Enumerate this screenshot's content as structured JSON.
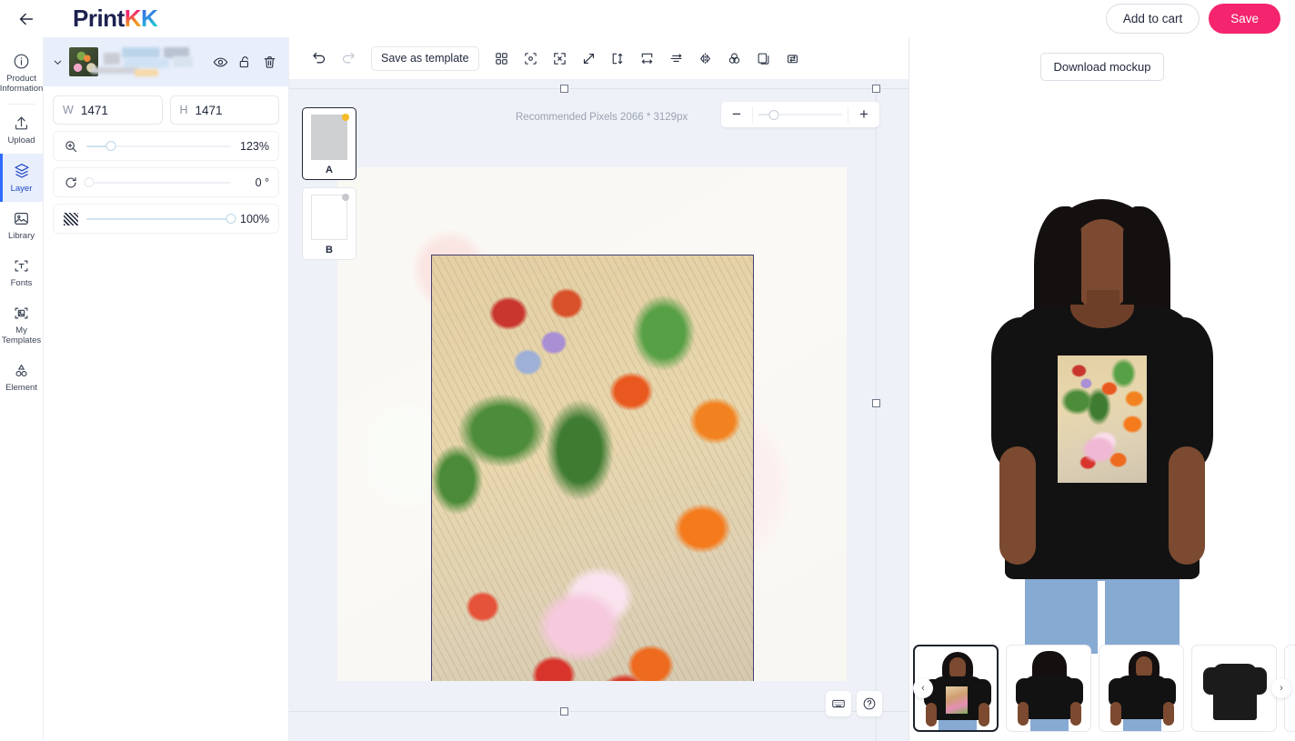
{
  "topbar": {
    "back_icon": "arrow-left-icon",
    "logo_part1": "Print",
    "logo_part2": "K",
    "logo_part3": "K",
    "add_to_cart_label": "Add to cart",
    "save_label": "Save",
    "save_color": "#f4246e"
  },
  "rail": {
    "items": [
      {
        "label": "Product\nInformation",
        "label_line1": "Product",
        "label_line2": "Information",
        "icon": "info-icon",
        "active": false
      },
      {
        "label": "Upload",
        "icon": "upload-icon",
        "active": false
      },
      {
        "label": "Layer",
        "icon": "layers-icon",
        "active": true
      },
      {
        "label": "Library",
        "icon": "image-icon",
        "active": false
      },
      {
        "label": "Fonts",
        "icon": "text-frame-icon",
        "active": false
      },
      {
        "label": "My\nTemplates",
        "label_line1": "My",
        "label_line2": "Templates",
        "icon": "image-frame-icon",
        "active": false
      },
      {
        "label": "Element",
        "icon": "shapes-icon",
        "active": false
      }
    ]
  },
  "properties": {
    "layer": {
      "collapse_icon": "chevron-down-icon",
      "thumbnail": "layer-thumbnail",
      "name_redacted": true,
      "visible_icon": "eye-icon",
      "lock_icon": "unlock-icon",
      "delete_icon": "trash-icon"
    },
    "width": {
      "label": "W",
      "value": "1471"
    },
    "height": {
      "label": "H",
      "value": "1471"
    },
    "scale": {
      "icon": "zoom-in-icon",
      "value": "123%",
      "percent": 17
    },
    "rotate": {
      "icon": "rotate-icon",
      "value": "0 °",
      "percent": 0
    },
    "opacity": {
      "icon": "opacity-icon",
      "value": "100%",
      "percent": 100
    }
  },
  "editor": {
    "toolbar": {
      "undo_icon": "undo-icon",
      "redo_icon": "redo-icon",
      "save_as_template_label": "Save as template",
      "tools": [
        {
          "icon": "grid-icon",
          "name": "grid-layout-tool"
        },
        {
          "icon": "center-icon",
          "name": "center-align-tool"
        },
        {
          "icon": "expand-icon",
          "name": "fit-to-area-tool"
        },
        {
          "icon": "diagonal-resize-icon",
          "name": "scale-tool"
        },
        {
          "icon": "fit-height-icon",
          "name": "fit-height-tool"
        },
        {
          "icon": "fit-width-icon",
          "name": "fit-width-tool"
        },
        {
          "icon": "align-vertical-icon",
          "name": "align-vertical-tool"
        },
        {
          "icon": "flip-horizontal-icon",
          "name": "flip-horizontal-tool"
        },
        {
          "icon": "color-circles-icon",
          "name": "color-tool"
        },
        {
          "icon": "duplicate-icon",
          "name": "duplicate-tool"
        },
        {
          "icon": "reset-icon",
          "name": "reset-tool"
        }
      ]
    },
    "recommended_text": "Recommended Pixels 2066 * 3129px",
    "zoom_control": {
      "minus": "−",
      "plus": "+",
      "percent": 18
    },
    "sides": [
      {
        "label": "A",
        "selected": true,
        "dot_color": "#f5bc28"
      },
      {
        "label": "B",
        "selected": false,
        "dot_color": "#c6c8cc"
      }
    ],
    "bottom_tools": [
      {
        "icon": "keyboard-icon",
        "name": "keyboard-shortcuts-button"
      },
      {
        "icon": "question-icon",
        "name": "help-button"
      }
    ]
  },
  "preview": {
    "download_mockup_label": "Download mockup",
    "thumbnails": [
      {
        "view": "front-model",
        "selected": true
      },
      {
        "view": "back-model",
        "selected": false
      },
      {
        "view": "side-model",
        "selected": false
      },
      {
        "view": "flat-front",
        "selected": false
      },
      {
        "view": "flat-angled",
        "selected": false
      }
    ],
    "prev_arrow": "‹",
    "next_arrow": "›"
  }
}
